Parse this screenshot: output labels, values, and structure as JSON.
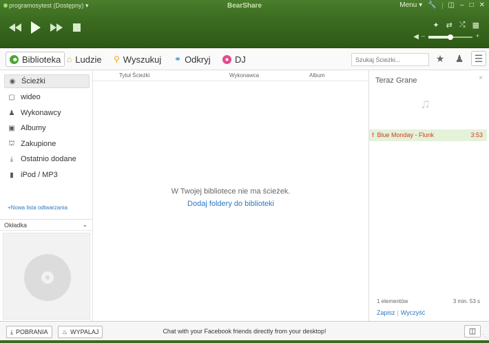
{
  "window": {
    "user_status": "programosytest (Dostępny) ▾",
    "title": "BearShare",
    "menu_label": "Menu ▾"
  },
  "nav": {
    "tabs": [
      {
        "label": "Biblioteka"
      },
      {
        "label": "Ludzie"
      },
      {
        "label": "Wyszukuj"
      },
      {
        "label": "Odkryj"
      },
      {
        "label": "DJ"
      }
    ],
    "search_placeholder": "Szukaj Ścieżki..."
  },
  "sidebar": {
    "items": [
      {
        "label": "Ścieżki"
      },
      {
        "label": "wideo"
      },
      {
        "label": "Wykonawcy"
      },
      {
        "label": "Albumy"
      },
      {
        "label": "Zakupione"
      },
      {
        "label": "Ostatnio dodane"
      },
      {
        "label": "iPod / MP3"
      }
    ],
    "new_playlist": "+Nowa lista odtwarzania",
    "cover_header": "Okładka"
  },
  "main": {
    "columns": [
      "Tytuł Ścieżki",
      "Wykonawca",
      "Album"
    ],
    "empty_message": "W Twojej bibliotece nie ma ścieżek.",
    "add_folders_link": "Dodaj foldery do biblioteki"
  },
  "now_playing": {
    "title": "Teraz Grane",
    "tracks": [
      {
        "marker": "!",
        "name": "Blue Monday - Flunk",
        "duration": "3:53"
      }
    ],
    "count": "1 elementów",
    "total_length": "3 min. 53 s",
    "save_label": "Zapisz",
    "clear_label": "Wyczyść"
  },
  "bottom": {
    "downloads_label": "POBRANIA",
    "burn_label": "WYPALAJ",
    "promo_text": "Chat with your Facebook friends directly from your desktop!"
  },
  "player": {
    "volume_fraction": 0.5
  },
  "colors": {
    "accent_green": "#3a6a1f",
    "link_blue": "#2b78c5",
    "track_highlight": "#e4f2d8",
    "track_text": "#d23b2b"
  }
}
